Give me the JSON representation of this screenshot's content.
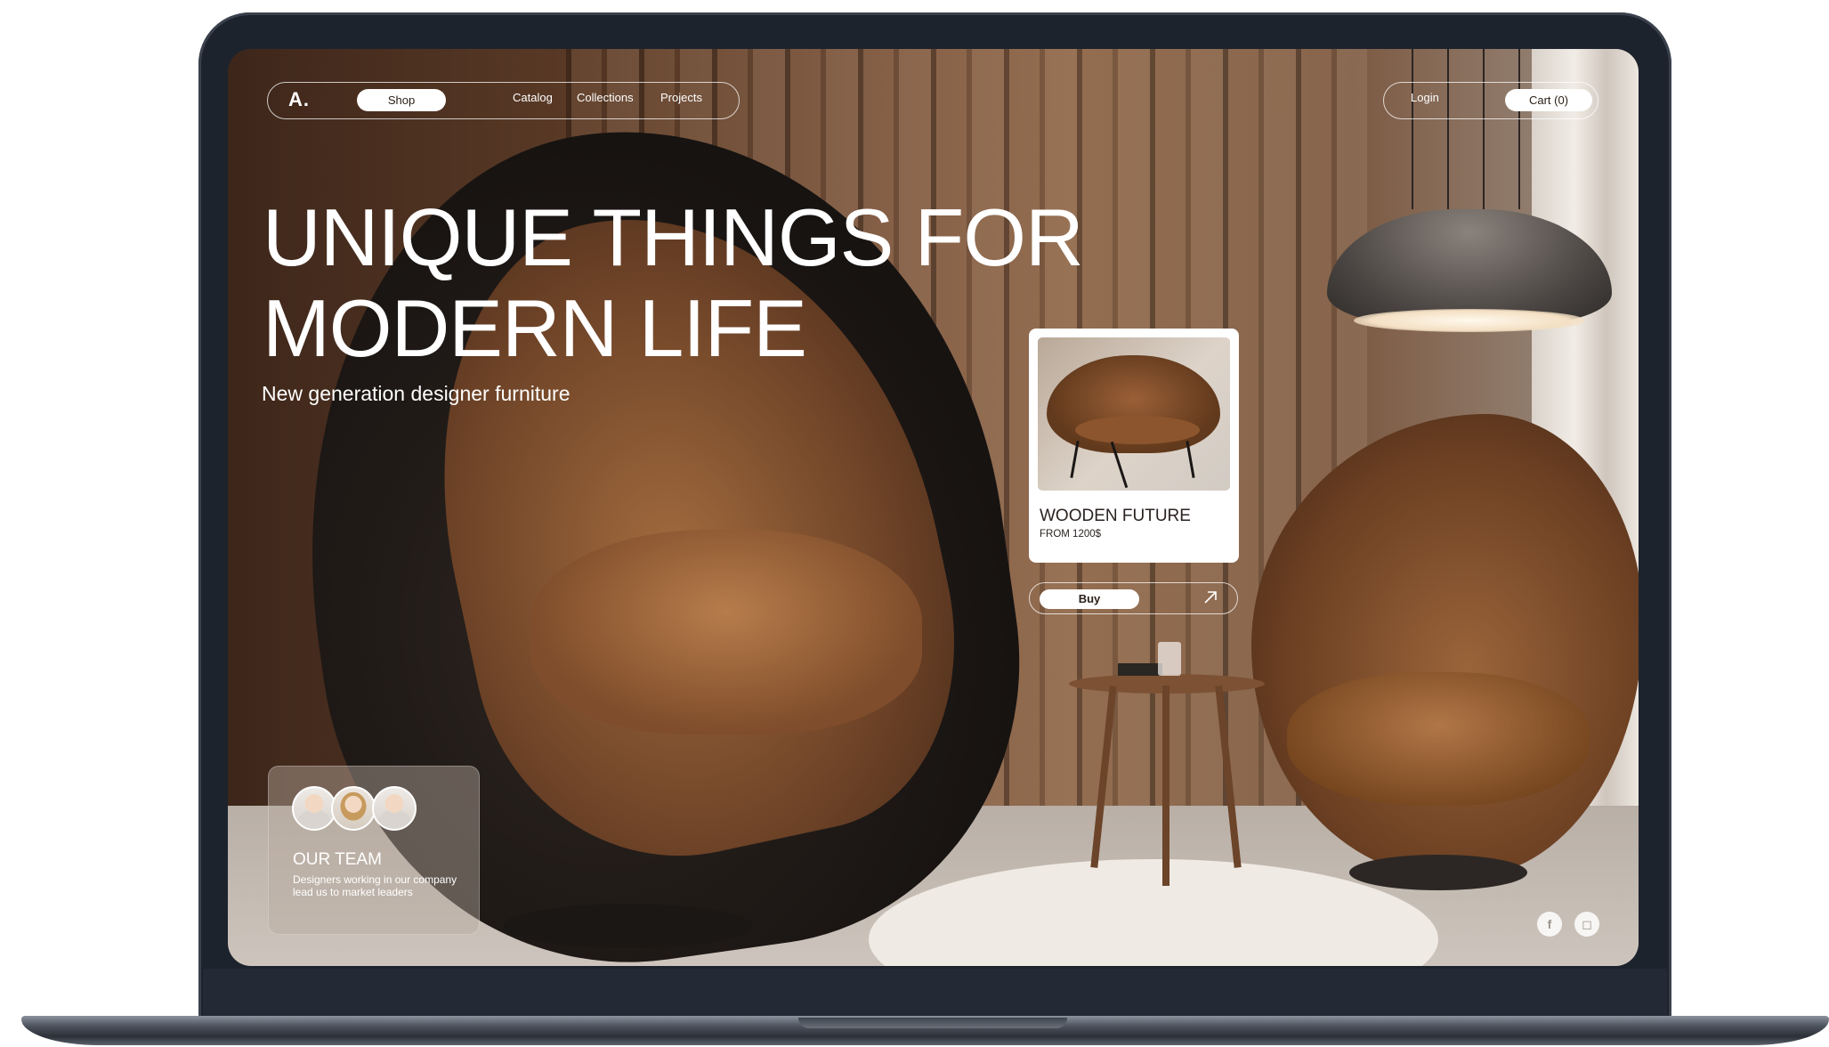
{
  "nav": {
    "logo": "A.",
    "shop_label": "Shop",
    "links": [
      "Catalog",
      "Collections",
      "Projects"
    ],
    "login_label": "Login",
    "cart_label": "Cart (0)"
  },
  "hero": {
    "title": "UNIQUE THINGS FOR MODERN LIFE",
    "subtitle": "New generation designer furniture"
  },
  "product": {
    "name": "WOODEN FUTURE",
    "price": "FROM 1200$",
    "buy_label": "Buy",
    "icon": "arrow-up-right-icon"
  },
  "team": {
    "title": "OUR TEAM",
    "description": "Designers working in our company lead us to market leaders",
    "avatars": [
      "team-member-avatar",
      "team-member-avatar",
      "team-member-avatar"
    ]
  },
  "social": {
    "icons": [
      "facebook-icon",
      "instagram-icon"
    ],
    "facebook_glyph": "f",
    "instagram_glyph": "◻"
  },
  "colors": {
    "accent": "#ffffff",
    "text_dark": "#2a2320",
    "wood": "#7e5840",
    "leather": "#a26b3e"
  }
}
